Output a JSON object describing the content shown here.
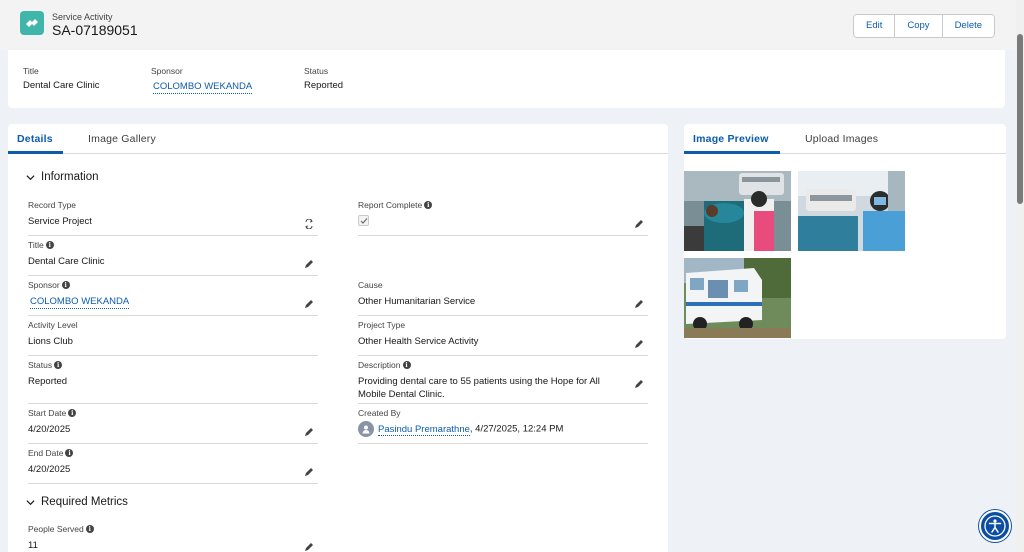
{
  "header": {
    "object_type": "Service Activity",
    "record_name": "SA-07189051",
    "buttons": {
      "edit": "Edit",
      "copy": "Copy",
      "delete": "Delete"
    }
  },
  "highlights": {
    "title_label": "Title",
    "title_value": "Dental Care Clinic",
    "sponsor_label": "Sponsor",
    "sponsor_value": "COLOMBO WEKANDA",
    "status_label": "Status",
    "status_value": "Reported"
  },
  "tabs": {
    "details": "Details",
    "gallery": "Image Gallery"
  },
  "information": {
    "heading": "Information",
    "record_type": {
      "label": "Record Type",
      "value": "Service Project"
    },
    "report_complete": {
      "label": "Report Complete",
      "checked": true
    },
    "title": {
      "label": "Title",
      "value": "Dental Care Clinic"
    },
    "sponsor": {
      "label": "Sponsor",
      "value": "COLOMBO WEKANDA"
    },
    "cause": {
      "label": "Cause",
      "value": "Other Humanitarian Service"
    },
    "activity_level": {
      "label": "Activity Level",
      "value": "Lions Club"
    },
    "project_type": {
      "label": "Project Type",
      "value": "Other Health Service Activity"
    },
    "status": {
      "label": "Status",
      "value": "Reported"
    },
    "description": {
      "label": "Description",
      "value": "Providing dental care to 55 patients using the Hope for All Mobile Dental Clinic."
    },
    "start_date": {
      "label": "Start Date",
      "value": "4/20/2025"
    },
    "created_by": {
      "label": "Created By",
      "user": "Pasindu Premarathne",
      "timestamp": ", 4/27/2025, 12:24 PM"
    },
    "end_date": {
      "label": "End Date",
      "value": "4/20/2025"
    }
  },
  "metrics": {
    "heading": "Required Metrics",
    "people_served": {
      "label": "People Served",
      "value": "11"
    }
  },
  "side_tabs": {
    "preview": "Image Preview",
    "upload": "Upload Images"
  },
  "images": [
    {
      "name": "dental-clinic-photo-1"
    },
    {
      "name": "dental-clinic-photo-2"
    },
    {
      "name": "mobile-clinic-van-photo"
    }
  ],
  "colors": {
    "brand_blue": "#0b5cab",
    "object_icon": "#3fb6a9",
    "page_bg": "#eef1f6"
  }
}
